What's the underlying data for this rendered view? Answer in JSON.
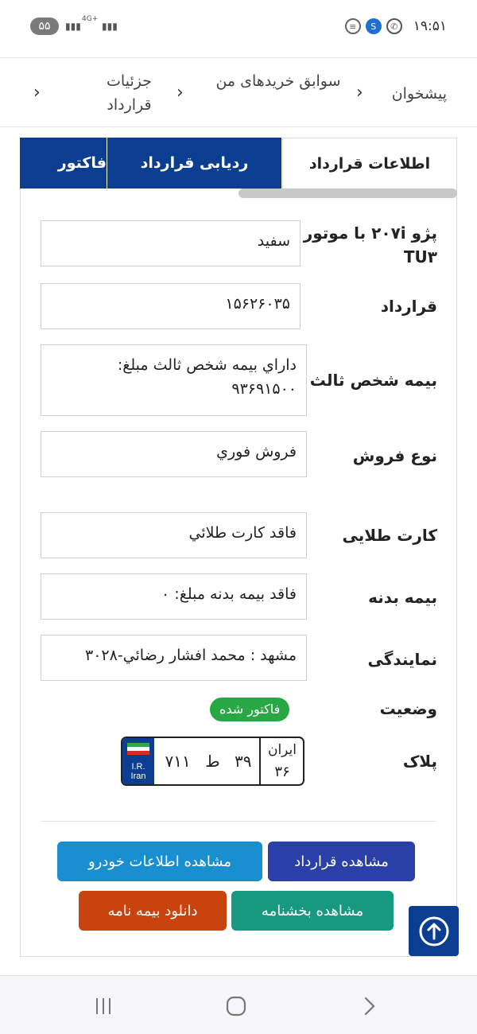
{
  "status_bar": {
    "time": "۱۹:۵۱",
    "battery": "۵۵",
    "network_label": "4G+"
  },
  "breadcrumb": {
    "items": [
      "پیشخوان",
      "سوابق خریدهای من",
      "جزئیات قرارداد"
    ]
  },
  "tabs": [
    "اطلاعات قرارداد",
    "ردیابی قرارداد",
    "فاکتور"
  ],
  "details": {
    "car_name": "پژو ۲۰۷i با موتور TU۳",
    "car_color": "سفید",
    "contract_label": "قرارداد",
    "contract_value": "۱۵۶۲۶۰۳۵",
    "third_party_label": "بیمه شخص ثالث",
    "third_party_value": "داراي بيمه شخص ثالث مبلغ: ۹۳۶۹۱۵۰۰",
    "sale_type_label": "نوع فروش",
    "sale_type_value": "فروش فوري",
    "gold_card_label": "کارت طلایی",
    "gold_card_value": "فاقد كارت طلائي",
    "body_insurance_label": "بیمه بدنه",
    "body_insurance_value": "فاقد بيمه بدنه مبلغ: ۰",
    "agency_label": "نمایندگی",
    "agency_value": "مشهد : محمد افشار رضائي-۳۰۲۸",
    "status_label": "وضعیت",
    "status_value": "فاکتور شده",
    "status_color": "#28a745",
    "plate_label": "پلاک"
  },
  "plate": {
    "country": "I.R. Iran",
    "number": "۳۹ ط ۷۱۱",
    "region_word": "ایران",
    "region_code": "۳۶"
  },
  "buttons": {
    "view_contract": "مشاهده قرارداد",
    "view_vehicle_info": "مشاهده اطلاعات خودرو",
    "view_circular": "مشاهده بخشنامه",
    "download_insurance": "دانلود بیمه نامه"
  },
  "colors": {
    "primary_blue": "#0b3d91",
    "indigo_button": "#2b3fa8",
    "cyan_button": "#1a8fd0",
    "teal_button": "#17997f",
    "orange_button": "#c9430f"
  }
}
